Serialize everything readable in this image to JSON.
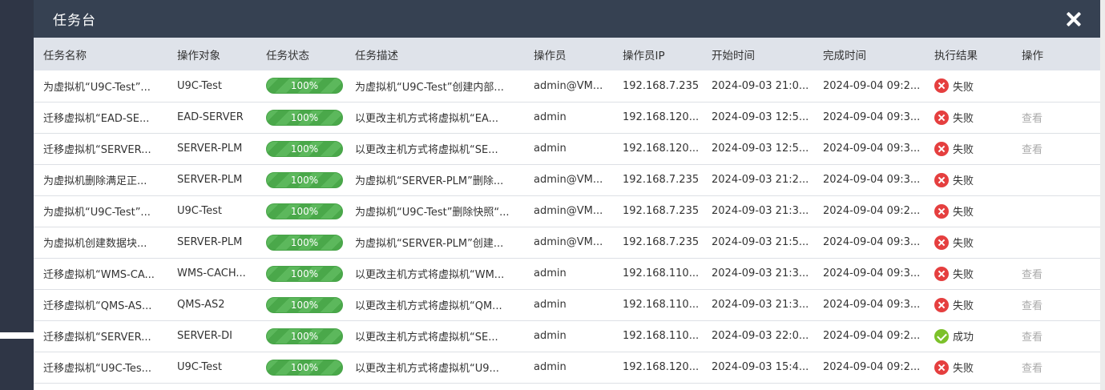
{
  "modal": {
    "title": "任务台"
  },
  "columns": [
    "任务名称",
    "操作对象",
    "任务状态",
    "任务描述",
    "操作员",
    "操作员IP",
    "开始时间",
    "完成时间",
    "执行结果",
    "操作"
  ],
  "rows": [
    {
      "name": "为虚拟机“U9C-Test”...",
      "target": "U9C-Test",
      "progress": 1.0,
      "progress_label": "100%",
      "desc": "为虚拟机“U9C-Test”创建内部...",
      "operator": "admin@VM...",
      "ip": "192.168.7.235",
      "start": "2024-09-03 21:0...",
      "end": "2024-09-04 09:2...",
      "result": "失败",
      "result_status": "fail",
      "action": ""
    },
    {
      "name": "迁移虚拟机“EAD-SE...",
      "target": "EAD-SERVER",
      "progress": 1.0,
      "progress_label": "100%",
      "desc": "以更改主机方式将虚拟机“EA...",
      "operator": "admin",
      "ip": "192.168.120...",
      "start": "2024-09-03 12:5...",
      "end": "2024-09-04 09:3...",
      "result": "失败",
      "result_status": "fail",
      "action": "查看"
    },
    {
      "name": "迁移虚拟机“SERVER...",
      "target": "SERVER-PLM",
      "progress": 1.0,
      "progress_label": "100%",
      "desc": "以更改主机方式将虚拟机“SE...",
      "operator": "admin",
      "ip": "192.168.120...",
      "start": "2024-09-03 12:5...",
      "end": "2024-09-04 09:3...",
      "result": "失败",
      "result_status": "fail",
      "action": "查看"
    },
    {
      "name": "为虚拟机删除满足正...",
      "target": "SERVER-PLM",
      "progress": 1.0,
      "progress_label": "100%",
      "desc": "为虚拟机“SERVER-PLM”删除...",
      "operator": "admin@VM...",
      "ip": "192.168.7.235",
      "start": "2024-09-03 21:2...",
      "end": "2024-09-04 09:3...",
      "result": "失败",
      "result_status": "fail",
      "action": ""
    },
    {
      "name": "为虚拟机“U9C-Test”...",
      "target": "U9C-Test",
      "progress": 1.0,
      "progress_label": "100%",
      "desc": "为虚拟机“U9C-Test”删除快照“...",
      "operator": "admin@VM...",
      "ip": "192.168.7.235",
      "start": "2024-09-03 21:3...",
      "end": "2024-09-04 09:2...",
      "result": "失败",
      "result_status": "fail",
      "action": ""
    },
    {
      "name": "为虚拟机创建数据块...",
      "target": "SERVER-PLM",
      "progress": 1.0,
      "progress_label": "100%",
      "desc": "为虚拟机“SERVER-PLM”创建...",
      "operator": "admin@VM...",
      "ip": "192.168.7.235",
      "start": "2024-09-03 21:5...",
      "end": "2024-09-04 09:3...",
      "result": "失败",
      "result_status": "fail",
      "action": ""
    },
    {
      "name": "迁移虚拟机“WMS-CA...",
      "target": "WMS-CACH...",
      "progress": 1.0,
      "progress_label": "100%",
      "desc": "以更改主机方式将虚拟机“WM...",
      "operator": "admin",
      "ip": "192.168.110...",
      "start": "2024-09-03 21:3...",
      "end": "2024-09-04 09:3...",
      "result": "失败",
      "result_status": "fail",
      "action": "查看"
    },
    {
      "name": "迁移虚拟机“QMS-AS...",
      "target": "QMS-AS2",
      "progress": 1.0,
      "progress_label": "100%",
      "desc": "以更改主机方式将虚拟机“QM...",
      "operator": "admin",
      "ip": "192.168.110...",
      "start": "2024-09-03 21:3...",
      "end": "2024-09-04 09:3...",
      "result": "失败",
      "result_status": "fail",
      "action": "查看"
    },
    {
      "name": "迁移虚拟机“SERVER...",
      "target": "SERVER-DI",
      "progress": 1.0,
      "progress_label": "100%",
      "desc": "以更改主机方式将虚拟机“SE...",
      "operator": "admin",
      "ip": "192.168.110...",
      "start": "2024-09-03 22:0...",
      "end": "2024-09-04 09:2...",
      "result": "成功",
      "result_status": "success",
      "action": "查看"
    },
    {
      "name": "迁移虚拟机“U9C-Tes...",
      "target": "U9C-Test",
      "progress": 1.0,
      "progress_label": "100%",
      "desc": "以更改主机方式将虚拟机“U9...",
      "operator": "admin",
      "ip": "192.168.120...",
      "start": "2024-09-03 15:4...",
      "end": "2024-09-04 09:2...",
      "result": "失败",
      "result_status": "fail",
      "action": "查看"
    }
  ],
  "colors": {
    "header_bg": "#364152",
    "table_header_bg": "#dfe3ea",
    "progress_green": "#5cb85c",
    "fail_red": "#e53f3f",
    "success_green": "#7cc12a",
    "action_gray": "#aaaaaa"
  },
  "icons": {
    "close": "close-icon",
    "fail": "fail-icon",
    "success": "success-icon"
  }
}
